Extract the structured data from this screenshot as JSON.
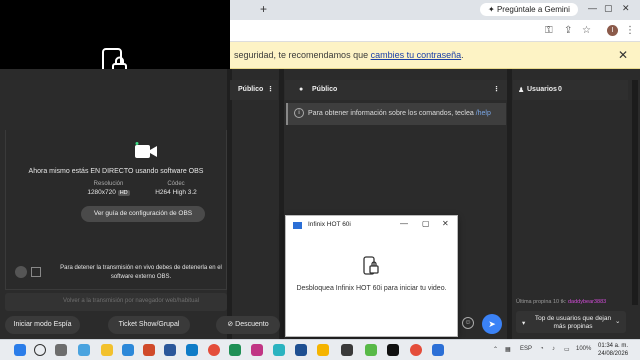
{
  "chrome": {
    "new_tab": "+",
    "gemini_label": "Pregúntale a Gemini",
    "min": "—",
    "max": "▢",
    "close": "✕",
    "avatar_letter": "I"
  },
  "password_bar": {
    "text_before": "seguridad, te recomendamos que ",
    "link": "cambies tu contraseña",
    "text_after": ".",
    "close": "✕"
  },
  "stream": {
    "live_text": "Ahora mismo estás EN DIRECTO usando software OBS",
    "resolution_label": "Resolución",
    "resolution_value": "1280x720",
    "hd_badge": "HD",
    "codec_label": "Códec",
    "codec_value": "H264 High 3.2",
    "guide_button": "Ver guía de configuración de OBS",
    "stop_text": "Para detener la transmisión en vivo debes de detenerla en el software externo OBS.",
    "input_placeholder": "Volver a la transmisión por navegador web/habitual"
  },
  "bottom_buttons": {
    "spy": "Iniciar modo Espía",
    "ticket": "Ticket Show/Grupal",
    "discount": "Descuento"
  },
  "columns": {
    "left_title": "Público",
    "mid_title": "Público",
    "right_title": "Usuarios",
    "right_count": "0"
  },
  "chat": {
    "info_text": "Para obtener información sobre los comandos, teclea ",
    "help_cmd": "/help"
  },
  "tips": {
    "last_tip_label": "Última propina 10 tk:",
    "last_tip_user": "daddybear3883",
    "top_users": "Top de usuarios que dejan más propinas"
  },
  "popup": {
    "title": "Infinix HOT 60i",
    "min": "—",
    "max": "▢",
    "close": "✕",
    "message": "Desbloquea Infinix HOT 60i para iniciar tu video."
  },
  "taskbar": {
    "lang": "ESP",
    "battery": "100%",
    "time": "01:34 a. m.",
    "date": "24/08/2026"
  }
}
